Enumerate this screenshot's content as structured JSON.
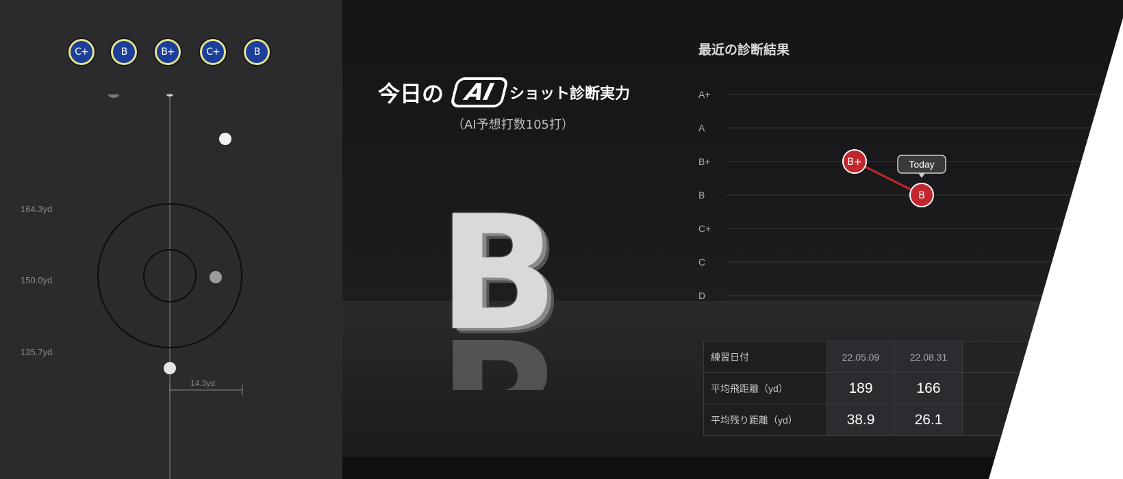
{
  "left_panel": {
    "grade_history": [
      "C+",
      "B",
      "B+",
      "C+",
      "B"
    ],
    "distance_labels": [
      "164.3yd",
      "150.0yd",
      "135.7yd"
    ],
    "dispersion_label": "14.3yd"
  },
  "today": {
    "title_prefix": "今日の",
    "ai_logo_text": "AI",
    "title_suffix": "ショット診断実力",
    "subtitle": "（AI予想打数105打）",
    "grade": "B"
  },
  "chart_data": {
    "type": "line",
    "title": "最近の診断結果",
    "y_categories": [
      "A+",
      "A",
      "B+",
      "B",
      "C+",
      "C",
      "D"
    ],
    "points": [
      {
        "date": "22.05.09",
        "grade": "B+"
      },
      {
        "date": "22.08.31",
        "grade": "B"
      }
    ],
    "annotation": "Today",
    "colors": {
      "point": "#c1272d",
      "line": "#c1272d",
      "grid": "#3a3a3e"
    }
  },
  "table": {
    "rows": [
      {
        "label": "練習日付",
        "values": [
          "22.05.09",
          "22.08.31"
        ]
      },
      {
        "label": "平均飛距離（yd）",
        "values": [
          "189",
          "166"
        ]
      },
      {
        "label": "平均残り距離（yd）",
        "values": [
          "38.9",
          "26.1"
        ]
      }
    ]
  }
}
